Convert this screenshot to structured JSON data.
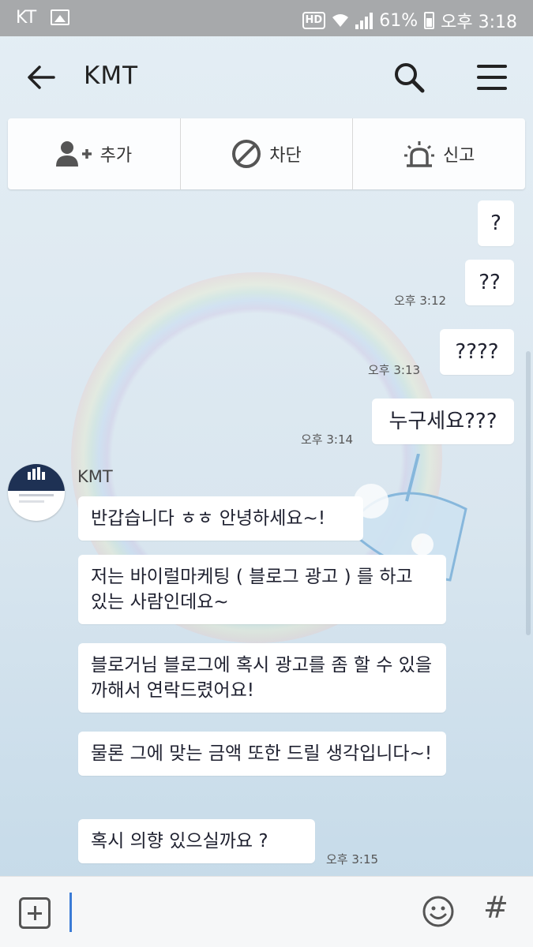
{
  "status_bar": {
    "carrier": "KT",
    "hd": "HD",
    "battery": "61%",
    "time": "오후 3:18"
  },
  "header": {
    "title": "KMT"
  },
  "actions": {
    "add": "추가",
    "block": "차단",
    "report": "신고"
  },
  "sent_messages": [
    {
      "text": "?",
      "time": ""
    },
    {
      "text": "??",
      "time": "오후 3:12"
    },
    {
      "text": "????",
      "time": "오후 3:13"
    },
    {
      "text": "누구세요???",
      "time": "오후 3:14"
    }
  ],
  "sender": {
    "name": "KMT"
  },
  "received_messages": [
    {
      "text": "반갑습니다 ㅎㅎ 안녕하세요~!"
    },
    {
      "text": "저는 바이럴마케팅 ( 블로그 광고 ) 를 하고 있는 사람인데요~"
    },
    {
      "text": "블로거님 블로그에 혹시 광고를 좀 할 수 있을까해서 연락드렸어요!"
    },
    {
      "text": "물론 그에 맞는 금액 또한 드릴 생각입니다~!"
    },
    {
      "text": "혹시 의향 있으실까요 ?"
    }
  ],
  "received_time": "오후 3:15",
  "input": {
    "value": ""
  },
  "colors": {
    "status_bar": "#a7a9ab",
    "cursor": "#3b7bd6",
    "avatar_brand": "#1e3154"
  }
}
